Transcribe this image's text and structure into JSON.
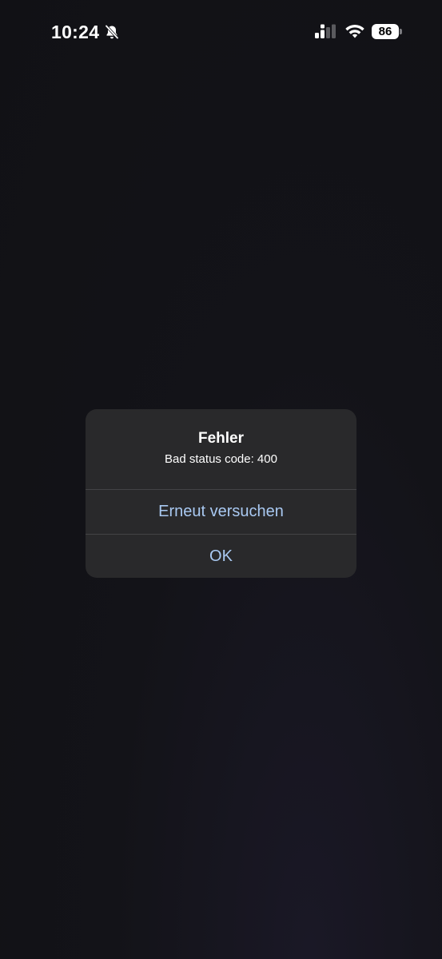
{
  "status_bar": {
    "time": "10:24",
    "mute_icon": "bell-slash-icon",
    "signal_icon": "cellular-signal-icon",
    "wifi_icon": "wifi-icon",
    "battery_level": "86"
  },
  "alert": {
    "title": "Fehler",
    "message": "Bad status code: 400",
    "buttons": [
      {
        "label": "Erneut versuchen"
      },
      {
        "label": "OK"
      }
    ],
    "button_color": "#a9c9f2",
    "background_color": "#29292b"
  }
}
